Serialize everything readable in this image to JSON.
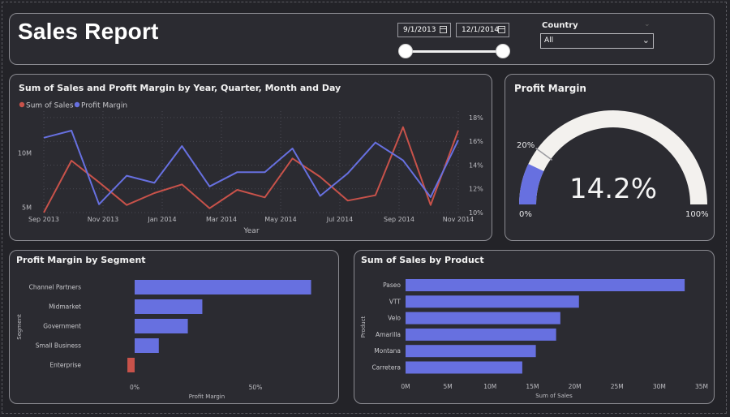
{
  "report_title": "Sales Report",
  "filters": {
    "start_date": "9/1/2013",
    "end_date": "12/1/2014",
    "country_label": "Country",
    "country_value": "All",
    "date_range_start_fraction": 0.0,
    "date_range_end_fraction": 1.0
  },
  "colors": {
    "sales": "#c8524a",
    "profit_margin": "#6770e0",
    "background": "#232328",
    "card": "#2b2b31",
    "gauge_track": "#f3f1ee"
  },
  "chart_data": [
    {
      "id": "line",
      "type": "line",
      "title": "Sum of Sales and Profit Margin by Year, Quarter, Month and Day",
      "xlabel": "Year",
      "x_tick_labels": [
        "Sep 2013",
        "Nov 2013",
        "Jan 2014",
        "Mar 2014",
        "May 2014",
        "Jul 2014",
        "Sep 2014",
        "Nov 2014"
      ],
      "left_axis": {
        "ticks": [
          "5M",
          "10M"
        ],
        "ylim": [
          4.5,
          13.5
        ]
      },
      "right_axis": {
        "ticks": [
          "10%",
          "12%",
          "14%",
          "16%",
          "18%"
        ],
        "ylim": [
          10,
          18.2
        ]
      },
      "legend": "top-left",
      "grid": true,
      "series": [
        {
          "name": "Sum of  Sales",
          "axis": "left",
          "values": [
            4.5,
            9.3,
            7.3,
            5.2,
            6.3,
            7.1,
            4.9,
            6.6,
            5.9,
            9.5,
            7.8,
            5.6,
            6.1,
            12.4,
            5.2,
            12.1
          ]
        },
        {
          "name": "Profit Margin",
          "axis": "right",
          "values": [
            16.3,
            16.9,
            10.7,
            13.1,
            12.5,
            15.6,
            12.2,
            13.4,
            13.4,
            15.4,
            11.4,
            13.3,
            15.9,
            14.4,
            11.3,
            16.1
          ]
        }
      ]
    },
    {
      "id": "gauge",
      "type": "gauge",
      "title": "Profit Margin",
      "value_label": "14.2%",
      "value": 14.2,
      "min": 0,
      "max": 100,
      "target": 20,
      "min_label": "0%",
      "max_label": "100%",
      "target_label": "20%"
    },
    {
      "id": "segment",
      "type": "bar",
      "orientation": "horizontal",
      "title": "Profit Margin by Segment",
      "ylabel": "Segment",
      "xlabel": "Profit Margin",
      "categories": [
        "Channel Partners",
        "Midmarket",
        "Government",
        "Small Business",
        "Enterprise"
      ],
      "values": [
        73,
        28,
        22,
        10,
        -3
      ],
      "x_ticks": [
        "0%",
        "50%"
      ],
      "xlim": [
        -5,
        95
      ]
    },
    {
      "id": "product",
      "type": "bar",
      "orientation": "horizontal",
      "title": "Sum of Sales by Product",
      "ylabel": "Product",
      "xlabel": "Sum of Sales",
      "categories": [
        "Paseo",
        "VTT",
        "Velo",
        "Amarilla",
        "Montana",
        "Carretera"
      ],
      "values": [
        33,
        20.5,
        18.3,
        17.8,
        15.4,
        13.8
      ],
      "x_ticks": [
        "0M",
        "5M",
        "10M",
        "15M",
        "20M",
        "25M",
        "30M",
        "35M"
      ],
      "xlim": [
        0,
        35
      ]
    }
  ]
}
